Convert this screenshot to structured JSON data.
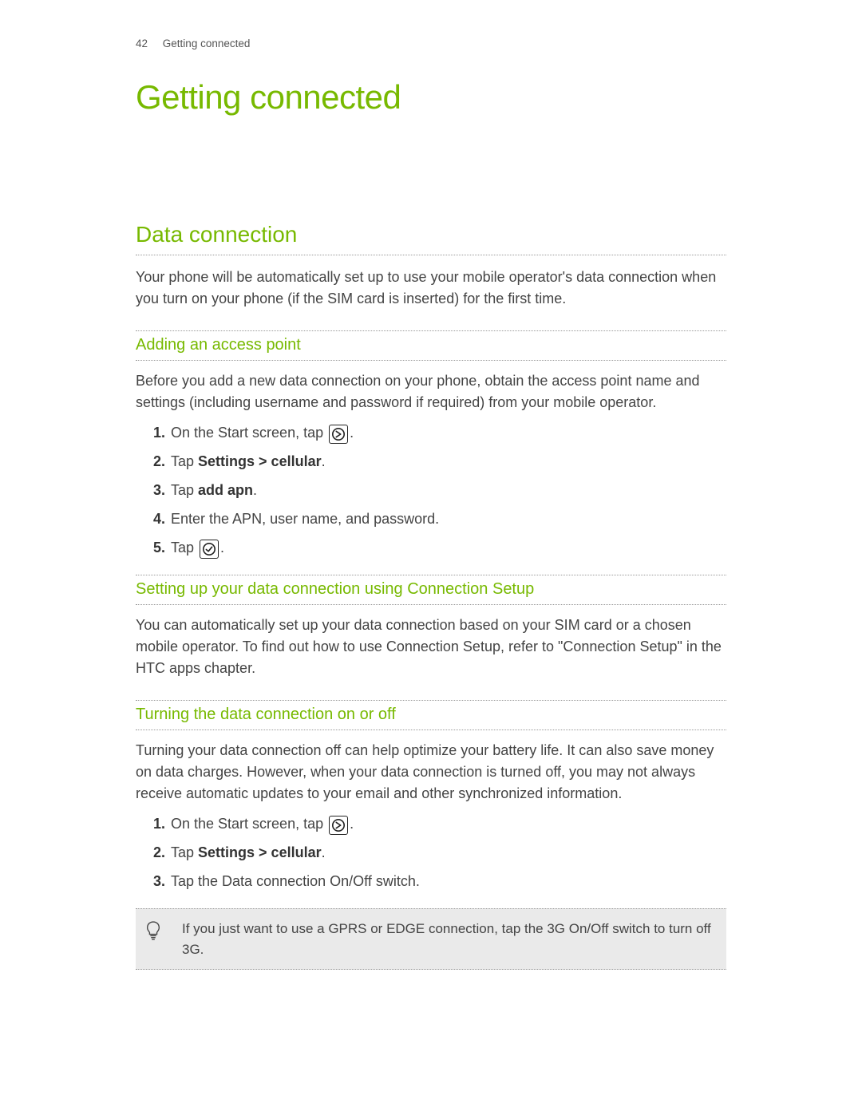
{
  "header": {
    "page_number": "42",
    "section_title": "Getting connected"
  },
  "title": "Getting connected",
  "section": {
    "heading": "Data connection",
    "intro": "Your phone will be automatically set up to use your mobile operator's data connection when you turn on your phone (if the SIM card is inserted) for the first time."
  },
  "sub1": {
    "heading": "Adding an access point",
    "intro": "Before you add a new data connection on your phone, obtain the access point name and settings (including username and password if required) from your mobile operator.",
    "steps": {
      "s1_pre": "On the Start screen, tap ",
      "s1_post": ".",
      "s2_pre": "Tap ",
      "s2_bold": "Settings > cellular",
      "s2_post": ".",
      "s3_pre": "Tap ",
      "s3_bold": "add apn",
      "s3_post": ".",
      "s4": "Enter the APN, user name, and password.",
      "s5_pre": "Tap ",
      "s5_post": "."
    }
  },
  "sub2": {
    "heading": "Setting up your data connection using Connection Setup",
    "body": "You can automatically set up your data connection based on your SIM card or a chosen mobile operator. To find out how to use Connection Setup, refer to \"Connection Setup\" in the HTC apps chapter."
  },
  "sub3": {
    "heading": "Turning the data connection on or off",
    "body": "Turning your data connection off can help optimize your battery life. It can also save money on data charges. However, when your data connection is turned off, you may not always receive automatic updates to your email and other synchronized information.",
    "steps": {
      "s1_pre": "On the Start screen, tap ",
      "s1_post": ".",
      "s2_pre": "Tap ",
      "s2_bold": "Settings > cellular",
      "s2_post": ".",
      "s3": "Tap the Data connection On/Off switch."
    }
  },
  "tip": {
    "text": "If you just want to use a GPRS or EDGE connection, tap the 3G On/Off switch to turn off 3G."
  }
}
